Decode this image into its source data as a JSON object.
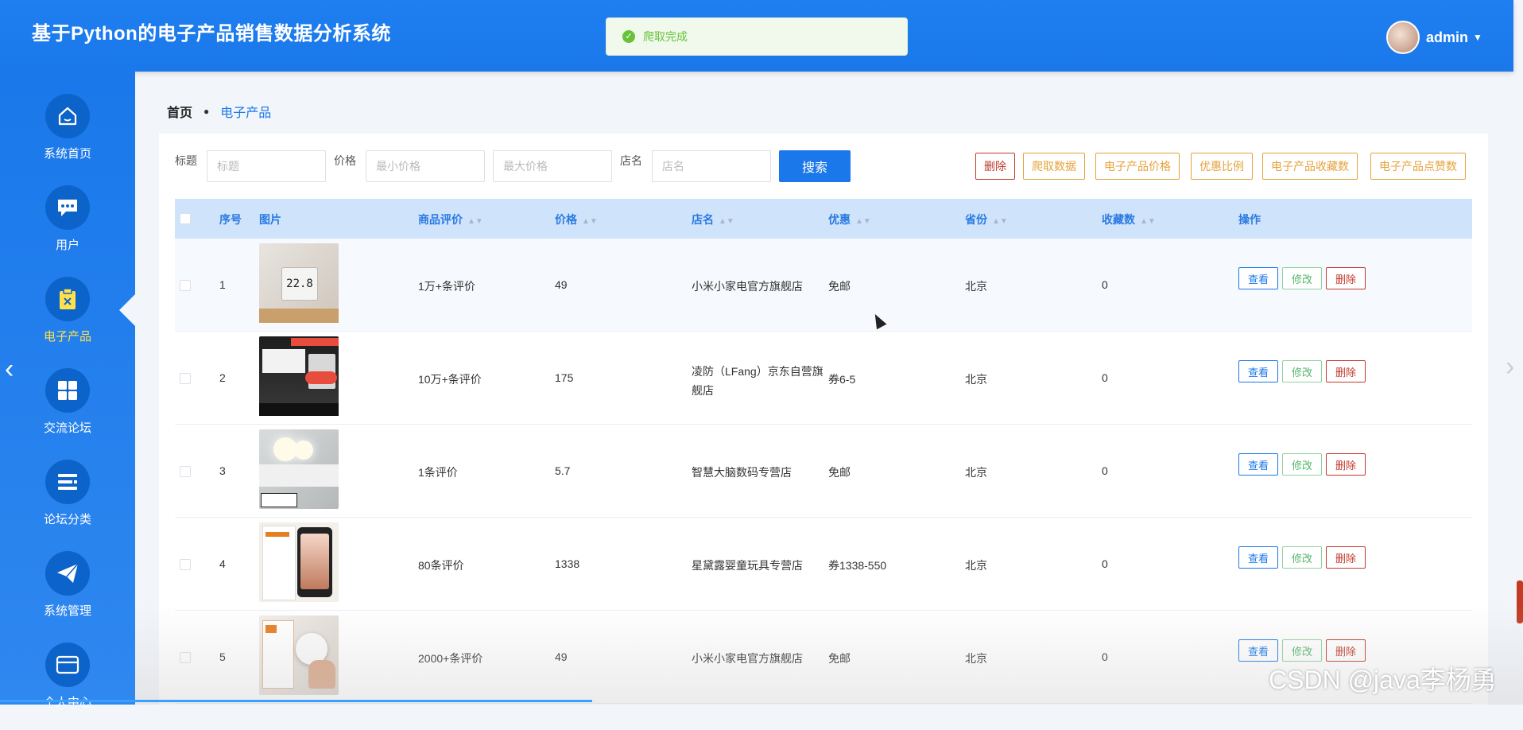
{
  "header": {
    "title": "基于Python的电子产品销售数据分析系统",
    "toast": "爬取完成",
    "username": "admin"
  },
  "sidebar": {
    "items": [
      {
        "label": "系统首页",
        "icon": "home-icon"
      },
      {
        "label": "用户",
        "icon": "chat-icon"
      },
      {
        "label": "电子产品",
        "icon": "clipboard-icon",
        "active": true
      },
      {
        "label": "交流论坛",
        "icon": "grid-icon"
      },
      {
        "label": "论坛分类",
        "icon": "list-icon"
      },
      {
        "label": "系统管理",
        "icon": "paper-plane-icon"
      },
      {
        "label": "个人中心",
        "icon": "card-icon"
      }
    ]
  },
  "breadcrumb": {
    "home": "首页",
    "current": "电子产品"
  },
  "filters": {
    "title_label": "标题",
    "title_placeholder": "标题",
    "price_label": "价格",
    "min_placeholder": "最小价格",
    "max_placeholder": "最大价格",
    "shop_label": "店名",
    "shop_placeholder": "店名",
    "search": "搜索"
  },
  "actions": [
    "删除",
    "爬取数据",
    "电子产品价格",
    "优惠比例",
    "电子产品收藏数",
    "电子产品点赞数"
  ],
  "table": {
    "columns": [
      "序号",
      "图片",
      "商品评价",
      "价格",
      "店名",
      "优惠",
      "省份",
      "收藏数",
      "操作"
    ],
    "row_buttons": {
      "view": "查看",
      "edit": "修改",
      "delete": "删除"
    },
    "rows": [
      {
        "no": "1",
        "review": "1万+条评价",
        "price": "49",
        "shop": "小米小家电官方旗舰店",
        "discount": "免邮",
        "province": "北京",
        "favorites": "0"
      },
      {
        "no": "2",
        "review": "10万+条评价",
        "price": "175",
        "shop": "凌防（LFang）京东自营旗舰店",
        "discount": "券6-5",
        "province": "北京",
        "favorites": "0"
      },
      {
        "no": "3",
        "review": "1条评价",
        "price": "5.7",
        "shop": "智慧大脑数码专营店",
        "discount": "免邮",
        "province": "北京",
        "favorites": "0"
      },
      {
        "no": "4",
        "review": "80条评价",
        "price": "1338",
        "shop": "星黛露婴童玩具专营店",
        "discount": "券1338-550",
        "province": "北京",
        "favorites": "0"
      },
      {
        "no": "5",
        "review": "2000+条评价",
        "price": "49",
        "shop": "小米小家电官方旗舰店",
        "discount": "免邮",
        "province": "北京",
        "favorites": "0"
      }
    ]
  },
  "watermark": "CSDN @java李杨勇",
  "colors": {
    "primary": "#1a78ea",
    "warning": "#e6a23c",
    "danger": "#c0392b",
    "success": "#67c23a"
  }
}
